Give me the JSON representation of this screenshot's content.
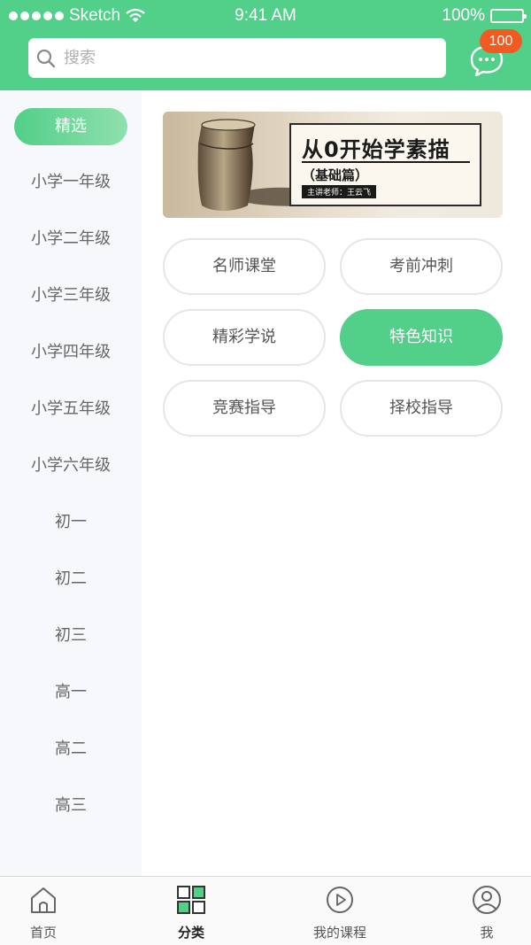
{
  "status_bar": {
    "carrier": "Sketch",
    "time": "9:41 AM",
    "battery": "100%"
  },
  "search": {
    "placeholder": "搜索"
  },
  "messages": {
    "badge": "100"
  },
  "sidebar": {
    "items": [
      {
        "label": "精选"
      },
      {
        "label": "小学一年级"
      },
      {
        "label": "小学二年级"
      },
      {
        "label": "小学三年级"
      },
      {
        "label": "小学四年级"
      },
      {
        "label": "小学五年级"
      },
      {
        "label": "小学六年级"
      },
      {
        "label": "初一"
      },
      {
        "label": "初二"
      },
      {
        "label": "初三"
      },
      {
        "label": "高一"
      },
      {
        "label": "高二"
      },
      {
        "label": "高三"
      }
    ]
  },
  "banner": {
    "title": "从0开始学素描",
    "subtitle": "（基础篇）",
    "teacher": "主讲老师：王云飞"
  },
  "categories": [
    {
      "label": "名师课堂"
    },
    {
      "label": "考前冲刺"
    },
    {
      "label": "精彩学说"
    },
    {
      "label": "特色知识"
    },
    {
      "label": "竞赛指导"
    },
    {
      "label": "择校指导"
    }
  ],
  "tabbar": {
    "items": [
      {
        "label": "首页",
        "icon": "home-icon"
      },
      {
        "label": "分类",
        "icon": "grid-icon"
      },
      {
        "label": "我的课程",
        "icon": "play-icon"
      },
      {
        "label": "我",
        "icon": "user-icon"
      }
    ]
  },
  "colors": {
    "accent": "#52cf89",
    "badge": "#f25a22",
    "sidebar_bg": "#f7f8fb"
  }
}
